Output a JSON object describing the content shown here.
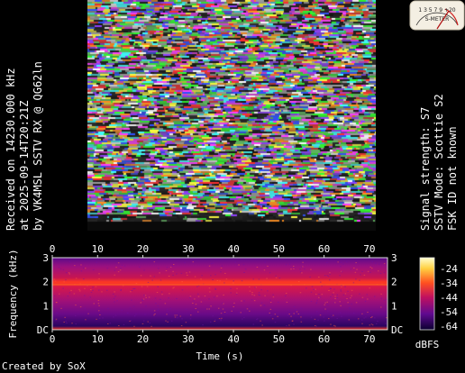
{
  "left_caption": {
    "line1": "Received on  14230.000 kHz",
    "line2": "at 2025-09-14T20:21Z",
    "line3": "by VK4MSL SSTV RX @ QG62ln"
  },
  "right_caption": {
    "line1": "Signal strength: S7",
    "line2": "SSTV Mode: Scottie S2",
    "line3": "FSK ID not known"
  },
  "meter": {
    "label": "S-METER",
    "scale": "1 3 5 7 9 +20",
    "icon": "s-meter-icon",
    "reading": "S7"
  },
  "spectrogram": {
    "x_axis_title": "Time (s)",
    "y_axis_title": "Frequency (kHz)",
    "x_ticks": [
      "0",
      "10",
      "20",
      "30",
      "40",
      "50",
      "60",
      "70"
    ],
    "y_ticks": [
      "DC",
      "1",
      "2",
      "3"
    ],
    "colorbar_ticks": [
      "-24",
      "-34",
      "-44",
      "-54",
      "-64"
    ],
    "colorbar_unit": "dBFS"
  },
  "footer": {
    "credit": "Created by SoX"
  },
  "colors": {
    "background": "#000000",
    "text": "#ffffff",
    "spectrum_low": "#1a0050",
    "spectrum_mid": "#b0107a",
    "spectrum_high": "#ff3030"
  }
}
